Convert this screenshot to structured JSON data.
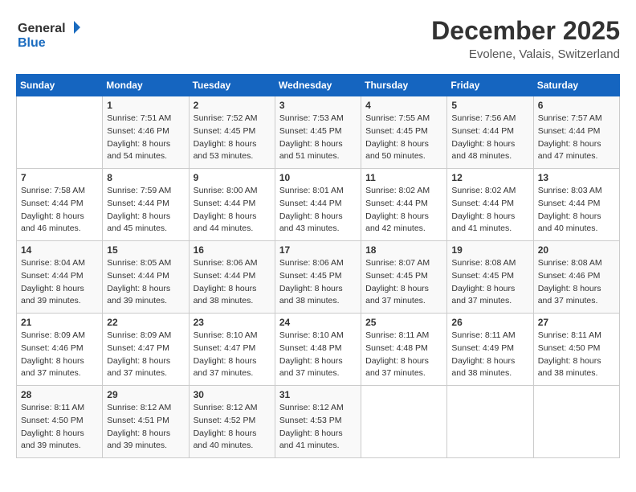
{
  "header": {
    "logo_line1": "General",
    "logo_line2": "Blue",
    "month_title": "December 2025",
    "location": "Evolene, Valais, Switzerland"
  },
  "days_of_week": [
    "Sunday",
    "Monday",
    "Tuesday",
    "Wednesday",
    "Thursday",
    "Friday",
    "Saturday"
  ],
  "weeks": [
    [
      {
        "day": "",
        "sunrise": "",
        "sunset": "",
        "daylight": ""
      },
      {
        "day": "1",
        "sunrise": "7:51 AM",
        "sunset": "4:46 PM",
        "daylight": "8 hours and 54 minutes."
      },
      {
        "day": "2",
        "sunrise": "7:52 AM",
        "sunset": "4:45 PM",
        "daylight": "8 hours and 53 minutes."
      },
      {
        "day": "3",
        "sunrise": "7:53 AM",
        "sunset": "4:45 PM",
        "daylight": "8 hours and 51 minutes."
      },
      {
        "day": "4",
        "sunrise": "7:55 AM",
        "sunset": "4:45 PM",
        "daylight": "8 hours and 50 minutes."
      },
      {
        "day": "5",
        "sunrise": "7:56 AM",
        "sunset": "4:44 PM",
        "daylight": "8 hours and 48 minutes."
      },
      {
        "day": "6",
        "sunrise": "7:57 AM",
        "sunset": "4:44 PM",
        "daylight": "8 hours and 47 minutes."
      }
    ],
    [
      {
        "day": "7",
        "sunrise": "7:58 AM",
        "sunset": "4:44 PM",
        "daylight": "8 hours and 46 minutes."
      },
      {
        "day": "8",
        "sunrise": "7:59 AM",
        "sunset": "4:44 PM",
        "daylight": "8 hours and 45 minutes."
      },
      {
        "day": "9",
        "sunrise": "8:00 AM",
        "sunset": "4:44 PM",
        "daylight": "8 hours and 44 minutes."
      },
      {
        "day": "10",
        "sunrise": "8:01 AM",
        "sunset": "4:44 PM",
        "daylight": "8 hours and 43 minutes."
      },
      {
        "day": "11",
        "sunrise": "8:02 AM",
        "sunset": "4:44 PM",
        "daylight": "8 hours and 42 minutes."
      },
      {
        "day": "12",
        "sunrise": "8:02 AM",
        "sunset": "4:44 PM",
        "daylight": "8 hours and 41 minutes."
      },
      {
        "day": "13",
        "sunrise": "8:03 AM",
        "sunset": "4:44 PM",
        "daylight": "8 hours and 40 minutes."
      }
    ],
    [
      {
        "day": "14",
        "sunrise": "8:04 AM",
        "sunset": "4:44 PM",
        "daylight": "8 hours and 39 minutes."
      },
      {
        "day": "15",
        "sunrise": "8:05 AM",
        "sunset": "4:44 PM",
        "daylight": "8 hours and 39 minutes."
      },
      {
        "day": "16",
        "sunrise": "8:06 AM",
        "sunset": "4:44 PM",
        "daylight": "8 hours and 38 minutes."
      },
      {
        "day": "17",
        "sunrise": "8:06 AM",
        "sunset": "4:45 PM",
        "daylight": "8 hours and 38 minutes."
      },
      {
        "day": "18",
        "sunrise": "8:07 AM",
        "sunset": "4:45 PM",
        "daylight": "8 hours and 37 minutes."
      },
      {
        "day": "19",
        "sunrise": "8:08 AM",
        "sunset": "4:45 PM",
        "daylight": "8 hours and 37 minutes."
      },
      {
        "day": "20",
        "sunrise": "8:08 AM",
        "sunset": "4:46 PM",
        "daylight": "8 hours and 37 minutes."
      }
    ],
    [
      {
        "day": "21",
        "sunrise": "8:09 AM",
        "sunset": "4:46 PM",
        "daylight": "8 hours and 37 minutes."
      },
      {
        "day": "22",
        "sunrise": "8:09 AM",
        "sunset": "4:47 PM",
        "daylight": "8 hours and 37 minutes."
      },
      {
        "day": "23",
        "sunrise": "8:10 AM",
        "sunset": "4:47 PM",
        "daylight": "8 hours and 37 minutes."
      },
      {
        "day": "24",
        "sunrise": "8:10 AM",
        "sunset": "4:48 PM",
        "daylight": "8 hours and 37 minutes."
      },
      {
        "day": "25",
        "sunrise": "8:11 AM",
        "sunset": "4:48 PM",
        "daylight": "8 hours and 37 minutes."
      },
      {
        "day": "26",
        "sunrise": "8:11 AM",
        "sunset": "4:49 PM",
        "daylight": "8 hours and 38 minutes."
      },
      {
        "day": "27",
        "sunrise": "8:11 AM",
        "sunset": "4:50 PM",
        "daylight": "8 hours and 38 minutes."
      }
    ],
    [
      {
        "day": "28",
        "sunrise": "8:11 AM",
        "sunset": "4:50 PM",
        "daylight": "8 hours and 39 minutes."
      },
      {
        "day": "29",
        "sunrise": "8:12 AM",
        "sunset": "4:51 PM",
        "daylight": "8 hours and 39 minutes."
      },
      {
        "day": "30",
        "sunrise": "8:12 AM",
        "sunset": "4:52 PM",
        "daylight": "8 hours and 40 minutes."
      },
      {
        "day": "31",
        "sunrise": "8:12 AM",
        "sunset": "4:53 PM",
        "daylight": "8 hours and 41 minutes."
      },
      {
        "day": "",
        "sunrise": "",
        "sunset": "",
        "daylight": ""
      },
      {
        "day": "",
        "sunrise": "",
        "sunset": "",
        "daylight": ""
      },
      {
        "day": "",
        "sunrise": "",
        "sunset": "",
        "daylight": ""
      }
    ]
  ]
}
